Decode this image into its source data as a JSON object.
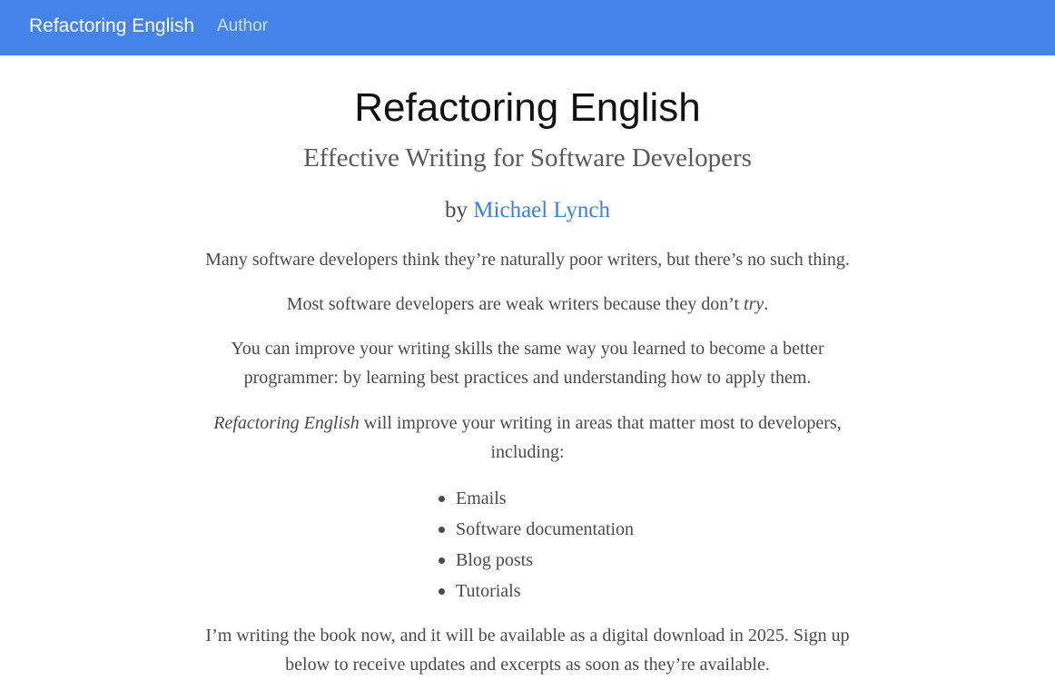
{
  "navbar": {
    "brand": "Refactoring English",
    "links": [
      "Author"
    ]
  },
  "header": {
    "title": "Refactoring English",
    "subtitle": "Effective Writing for Software Developers",
    "byline_prefix": "by",
    "author": "Michael Lynch"
  },
  "content": {
    "p1": "Many software developers think they’re naturally poor writers, but there’s no such thing.",
    "p2_before": "Most software developers are weak writers because they don’t ",
    "p2_em": "try",
    "p2_after": ".",
    "p3": "You can improve your writing skills the same way you learned to become a better programmer: by learning best practices and understanding how to apply them.",
    "p4_em": "Refactoring English",
    "p4_after": " will improve your writing in areas that matter most to developers, including:",
    "list": [
      "Emails",
      "Software documentation",
      "Blog posts",
      "Tutorials"
    ],
    "p5": "I’m writing the book now, and it will be available as a digital download in 2025. Sign up below to receive updates and excerpts as soon as they’re available."
  },
  "colors": {
    "navbar_bg": "#4484e9",
    "link": "#3f7fe0",
    "text": "#4a4a4a"
  }
}
